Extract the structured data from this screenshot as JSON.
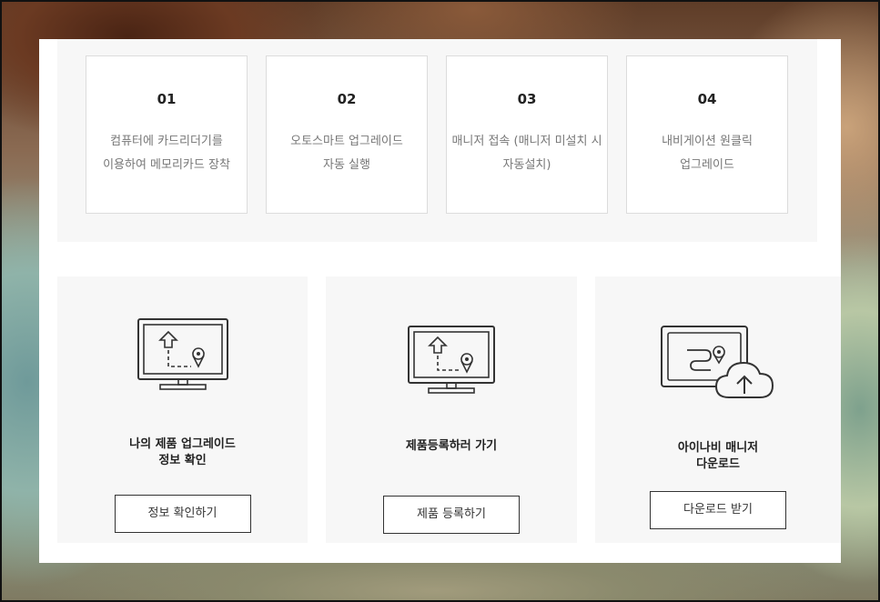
{
  "steps": [
    {
      "num": "01",
      "desc": "컴퓨터에 카드리더기를 이용하여 메모리카드 장착"
    },
    {
      "num": "02",
      "desc": "오토스마트 업그레이드 자동 실행"
    },
    {
      "num": "03",
      "desc": "매니저 접속 (매니저 미설치 시 자동설치)"
    },
    {
      "num": "04",
      "desc": "내비게이션 원클릭 업그레이드"
    }
  ],
  "cards": [
    {
      "title": "나의 제품 업그레이드\n정보 확인",
      "button": "정보 확인하기",
      "icon": "monitor-map-icon"
    },
    {
      "title": "제품등록하러 가기",
      "button": "제품 등록하기",
      "icon": "monitor-route-icon"
    },
    {
      "title": "아이나비 매니저\n다운로드",
      "button": "다운로드 받기",
      "icon": "cloud-upload-icon"
    }
  ],
  "colors": {
    "panel": "#ffffff",
    "area": "#f7f7f7",
    "text": "#222222",
    "muted": "#777777",
    "border": "#333333"
  }
}
